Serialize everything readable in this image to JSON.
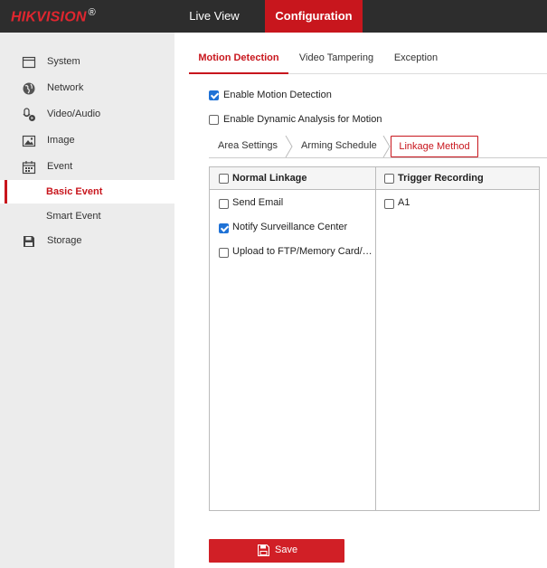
{
  "header": {
    "logo_text": "HIKVISION",
    "logo_mark": "®",
    "nav": {
      "live_view": "Live View",
      "configuration": "Configuration"
    },
    "active_nav": "configuration",
    "colors": {
      "bar_bg": "#2d2d2d",
      "accent": "#c8161d"
    }
  },
  "sidebar": {
    "items": [
      {
        "label": "System",
        "icon": "monitor-icon"
      },
      {
        "label": "Network",
        "icon": "globe-icon"
      },
      {
        "label": "Video/Audio",
        "icon": "mic-video-icon"
      },
      {
        "label": "Image",
        "icon": "image-icon"
      },
      {
        "label": "Event",
        "icon": "calendar-icon"
      },
      {
        "label": "Storage",
        "icon": "storage-icon"
      }
    ],
    "subitems": [
      {
        "label": "Basic Event",
        "active": true
      },
      {
        "label": "Smart Event",
        "active": false
      }
    ]
  },
  "tabs": {
    "items": [
      "Motion Detection",
      "Video Tampering",
      "Exception"
    ],
    "active": "Motion Detection"
  },
  "options": {
    "enable_motion": {
      "label": "Enable Motion Detection",
      "checked": true
    },
    "enable_dynamic": {
      "label": "Enable Dynamic Analysis for Motion",
      "checked": false
    }
  },
  "subtabs": {
    "items": [
      "Area Settings",
      "Arming Schedule",
      "Linkage Method"
    ],
    "active": "Linkage Method"
  },
  "linkage": {
    "normal": {
      "header": "Normal Linkage",
      "header_checked": false,
      "items": [
        {
          "label": "Send Email",
          "checked": false
        },
        {
          "label": "Notify Surveillance Center",
          "checked": true
        },
        {
          "label": "Upload to FTP/Memory Card/…",
          "checked": false
        }
      ]
    },
    "trigger": {
      "header": "Trigger Recording",
      "header_checked": false,
      "items": [
        {
          "label": "A1",
          "checked": false
        }
      ]
    }
  },
  "save_button": {
    "label": "Save",
    "icon": "save-disk-icon"
  }
}
